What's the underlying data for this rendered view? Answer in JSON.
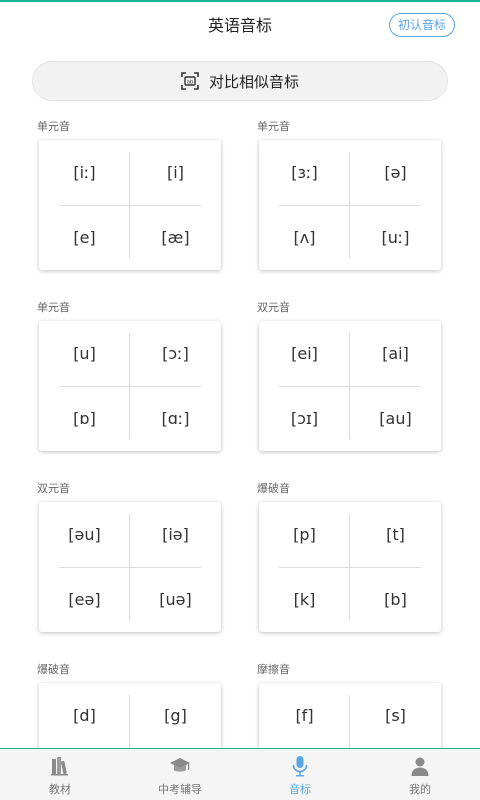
{
  "header": {
    "title": "英语音标",
    "button_label": "初认音标"
  },
  "compare": {
    "label": "对比相似音标"
  },
  "groups": [
    {
      "title": "单元音",
      "symbols": [
        "[iː]",
        "[i]",
        "[e]",
        "[æ]"
      ]
    },
    {
      "title": "单元音",
      "symbols": [
        "[ɜː]",
        "[ə]",
        "[ʌ]",
        "[uː]"
      ]
    },
    {
      "title": "单元音",
      "symbols": [
        "[u]",
        "[ɔː]",
        "[ɒ]",
        "[ɑː]"
      ]
    },
    {
      "title": "双元音",
      "symbols": [
        "[ei]",
        "[ai]",
        "[ɔɪ]",
        "[au]"
      ]
    },
    {
      "title": "双元音",
      "symbols": [
        "[əu]",
        "[iə]",
        "[eə]",
        "[uə]"
      ]
    },
    {
      "title": "爆破音",
      "symbols": [
        "[p]",
        "[t]",
        "[k]",
        "[b]"
      ]
    },
    {
      "title": "爆破音",
      "symbols": [
        "[d]",
        "[g]",
        "",
        ""
      ]
    },
    {
      "title": "摩擦音",
      "symbols": [
        "[f]",
        "[s]",
        "",
        ""
      ]
    }
  ],
  "tabs": [
    {
      "label": "教材",
      "icon": "books-icon"
    },
    {
      "label": "中考辅导",
      "icon": "graduation-cap-icon"
    },
    {
      "label": "音标",
      "icon": "microphone-icon"
    },
    {
      "label": "我的",
      "icon": "user-icon"
    }
  ],
  "colors": {
    "accent": "#5aa6e4",
    "topline": "#1ab394"
  }
}
